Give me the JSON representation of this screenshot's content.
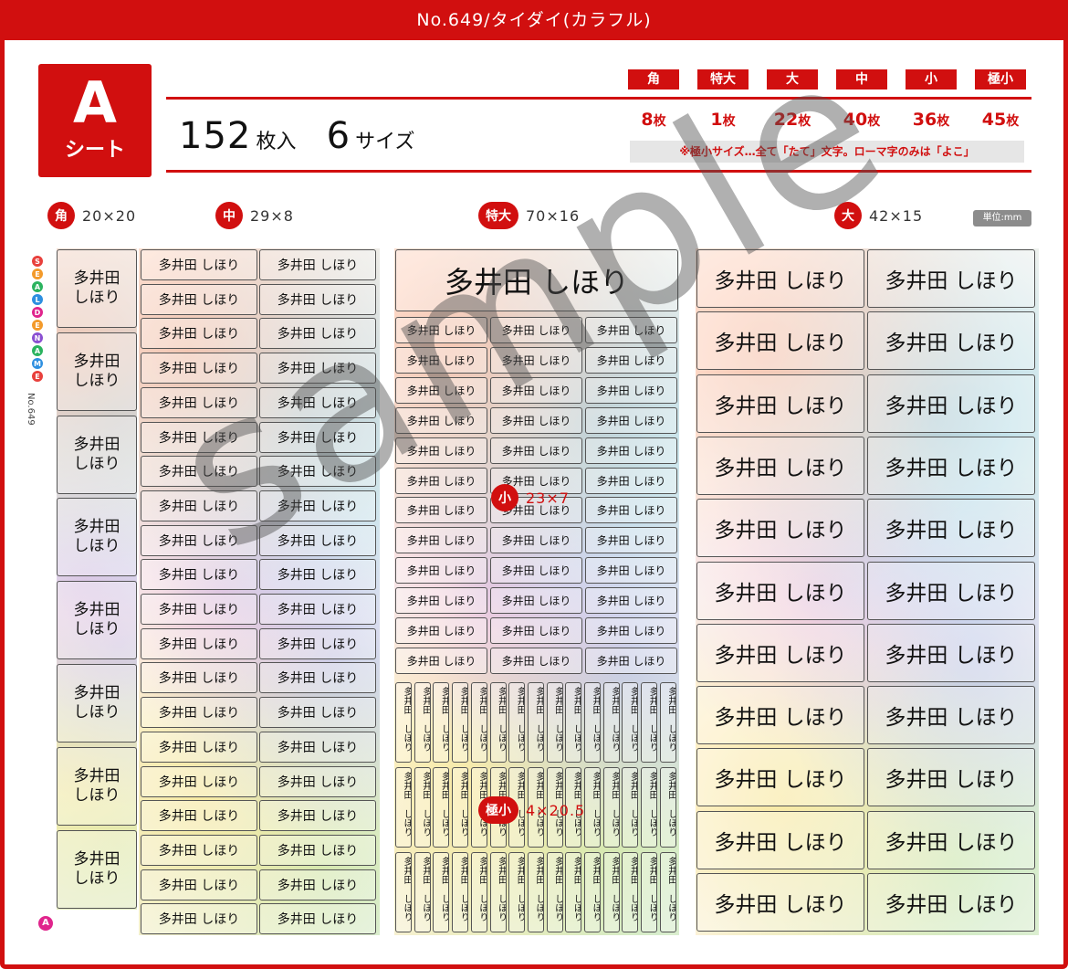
{
  "header": {
    "title": "No.649/タイダイ(カラフル)"
  },
  "sheet": {
    "letter": "A",
    "word": "シート"
  },
  "summary": {
    "count": "152",
    "count_unit": "枚入",
    "sizes": "6",
    "sizes_unit": "サイズ"
  },
  "sizes": [
    {
      "name": "角",
      "count": "8",
      "unit": "枚"
    },
    {
      "name": "特大",
      "count": "1",
      "unit": "枚"
    },
    {
      "name": "大",
      "count": "22",
      "unit": "枚"
    },
    {
      "name": "中",
      "count": "40",
      "unit": "枚"
    },
    {
      "name": "小",
      "count": "36",
      "unit": "枚"
    },
    {
      "name": "極小",
      "count": "45",
      "unit": "枚"
    }
  ],
  "note": "※極小サイズ…全て「たて」文字。ローマ字のみは「よこ」",
  "legends": {
    "kaku": {
      "name": "角",
      "dim": "20×20"
    },
    "chu": {
      "name": "中",
      "dim": "29×8"
    },
    "tokudai": {
      "name": "特大",
      "dim": "70×16"
    },
    "dai": {
      "name": "大",
      "dim": "42×15"
    },
    "sho": {
      "name": "小",
      "dim": "23×7"
    },
    "gokusho": {
      "name": "極小",
      "dim": "4×20.5"
    }
  },
  "unit_tag": "単位:mm",
  "label_text": {
    "one_line": "多井田 しほり",
    "kaku_line1": "多井田",
    "kaku_line2": "しほり"
  },
  "watermark": "sample",
  "brand": {
    "letters": [
      "S",
      "E",
      "A",
      "L",
      "D",
      "E",
      "N",
      "A",
      "M",
      "E"
    ],
    "number": "No.649",
    "badge": "A"
  },
  "colors": {
    "accent": "#d10f0f"
  }
}
